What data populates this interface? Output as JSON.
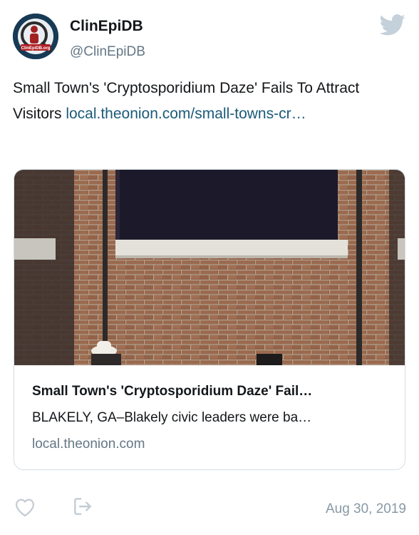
{
  "author": {
    "display_name": "ClinEpiDB",
    "handle": "@ClinEpiDB",
    "avatar_label": "ClinEpiDB.org"
  },
  "tweet": {
    "text": "Small Town's 'Cryptosporidium Daze' Fails To Attract Visitors ",
    "link_text": "local.theonion.com/small-towns-cr…"
  },
  "card": {
    "title": "Small Town's 'Cryptosporidium Daze' Fail…",
    "description": "BLAKELY, GA–Blakely civic leaders were ba…",
    "domain": "local.theonion.com"
  },
  "footer": {
    "timestamp": "Aug 30, 2019"
  },
  "icons": {
    "brand": "twitter-bird-icon",
    "like": "heart-icon",
    "share": "share-icon"
  },
  "colors": {
    "link": "#1b5a79",
    "muted": "#657786",
    "twitter_bird": "#c4d0da"
  }
}
